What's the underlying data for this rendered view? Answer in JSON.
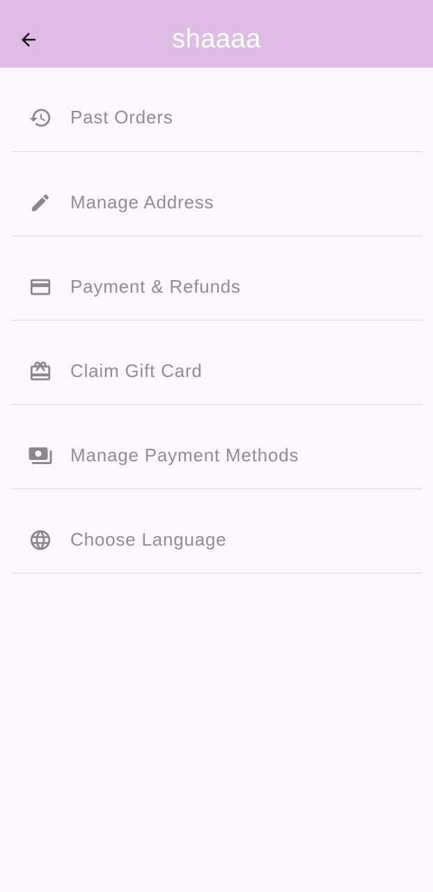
{
  "appbar": {
    "title": "shaaaa",
    "background": "#dfbce5",
    "back_icon": "arrow-back-icon"
  },
  "menu": {
    "items": [
      {
        "label": "Past Orders",
        "icon": "history-icon"
      },
      {
        "label": "Manage Address",
        "icon": "pencil-icon"
      },
      {
        "label": "Payment & Refunds",
        "icon": "credit-card-icon"
      },
      {
        "label": "Claim Gift Card",
        "icon": "gift-card-icon"
      },
      {
        "label": "Manage Payment Methods",
        "icon": "payments-icon"
      },
      {
        "label": "Choose Language",
        "icon": "globe-icon"
      }
    ]
  },
  "colors": {
    "text": "#8f8c92",
    "icon": "#8a878d",
    "divider": "#d9d5d9",
    "page_background": "#fdf7fd"
  }
}
